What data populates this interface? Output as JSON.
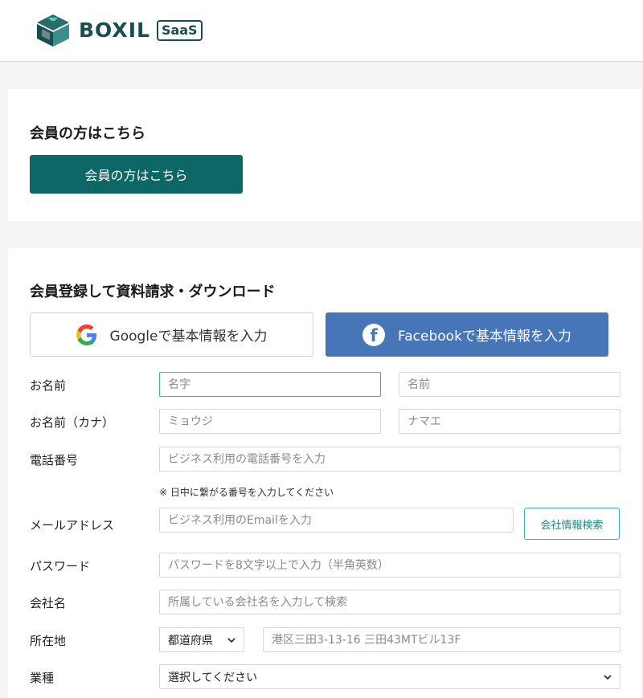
{
  "brand": {
    "name": "BOXIL",
    "badge": "SaaS"
  },
  "member_section": {
    "heading": "会員の方はこちら",
    "button_label": "会員の方はこちら"
  },
  "register_section": {
    "heading": "会員登録して資料請求・ダウンロード",
    "google_label": "Googleで基本情報を入力",
    "facebook_label": "Facebookで基本情報を入力",
    "facebook_glyph": "f"
  },
  "form": {
    "name": {
      "label": "お名前",
      "last_placeholder": "名字",
      "first_placeholder": "名前"
    },
    "kana": {
      "label": "お名前（カナ）",
      "last_placeholder": "ミョウジ",
      "first_placeholder": "ナマエ"
    },
    "phone": {
      "label": "電話番号",
      "placeholder": "ビジネス利用の電話番号を入力",
      "note": "※ 日中に繋がる番号を入力してください"
    },
    "email": {
      "label": "メールアドレス",
      "placeholder": "ビジネス利用のEmailを入力",
      "search_button": "会社情報検索"
    },
    "password": {
      "label": "パスワード",
      "placeholder": "パスワードを8文字以上で入力（半角英数）"
    },
    "company": {
      "label": "会社名",
      "placeholder": "所属している会社名を入力して検索"
    },
    "address": {
      "label": "所在地",
      "prefecture_selected": "都道府県",
      "placeholder": "港区三田3-13-16 三田43MTビル13F"
    },
    "industry": {
      "label": "業種",
      "selected": "選択してください"
    }
  },
  "colors": {
    "primary": "#0d6766",
    "facebook": "#4676b8",
    "focus": "#3bb3ad",
    "brand": "#1a4e4e"
  }
}
